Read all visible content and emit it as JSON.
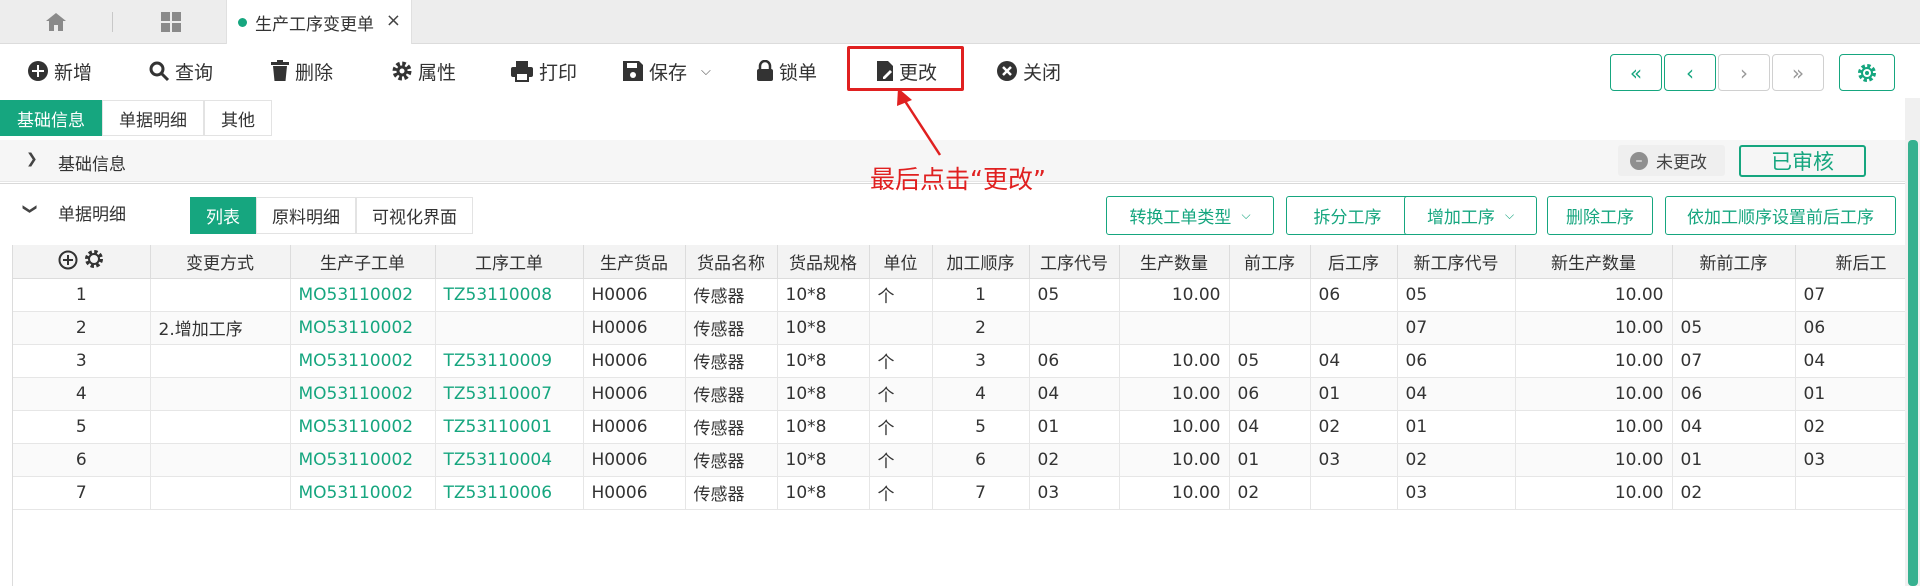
{
  "tabbar": {
    "doc_tab_label": "生产工序变更单",
    "close_glyph": "×"
  },
  "toolbar": {
    "new": "新增",
    "query": "查询",
    "delete": "删除",
    "properties": "属性",
    "print": "打印",
    "save": "保存",
    "lock": "锁单",
    "change": "更改",
    "close": "关闭"
  },
  "nav": {
    "first": "«",
    "prev": "‹",
    "next": "›",
    "last": "»"
  },
  "section_tabs": [
    "基础信息",
    "单据明细",
    "其他"
  ],
  "basic": {
    "title": "基础信息",
    "status": "未更改",
    "audited": "已审核"
  },
  "detail": {
    "title": "单据明细",
    "subtabs": [
      "列表",
      "原料明细",
      "可视化界面"
    ],
    "actions": {
      "convert_type": "转换工单类型",
      "split": "拆分工序",
      "add": "增加工序",
      "delete": "删除工序",
      "set_order": "依加工顺序设置前后工序"
    }
  },
  "annotation": "最后点击“更改”",
  "colors": {
    "accent": "#16a67f",
    "annotation": "#e02020"
  },
  "table": {
    "headers": [
      "",
      "变更方式",
      "生产子工单",
      "工序工单",
      "生产货品",
      "货品名称",
      "货品规格",
      "单位",
      "加工顺序",
      "工序代号",
      "生产数量",
      "前工序",
      "后工序",
      "新工序代号",
      "新生产数量",
      "新前工序",
      "新后工"
    ],
    "rows": [
      [
        "1",
        "",
        "MO53110002",
        "TZ53110008",
        "H0006",
        "传感器",
        "10*8",
        "个",
        "1",
        "05",
        "10.00",
        "",
        "06",
        "05",
        "10.00",
        "",
        "07"
      ],
      [
        "2",
        "2.增加工序",
        "MO53110002",
        "",
        "H0006",
        "传感器",
        "10*8",
        "",
        "2",
        "",
        "",
        "",
        "",
        "07",
        "10.00",
        "05",
        "06"
      ],
      [
        "3",
        "",
        "MO53110002",
        "TZ53110009",
        "H0006",
        "传感器",
        "10*8",
        "个",
        "3",
        "06",
        "10.00",
        "05",
        "04",
        "06",
        "10.00",
        "07",
        "04"
      ],
      [
        "4",
        "",
        "MO53110002",
        "TZ53110007",
        "H0006",
        "传感器",
        "10*8",
        "个",
        "4",
        "04",
        "10.00",
        "06",
        "01",
        "04",
        "10.00",
        "06",
        "01"
      ],
      [
        "5",
        "",
        "MO53110002",
        "TZ53110001",
        "H0006",
        "传感器",
        "10*8",
        "个",
        "5",
        "01",
        "10.00",
        "04",
        "02",
        "01",
        "10.00",
        "04",
        "02"
      ],
      [
        "6",
        "",
        "MO53110002",
        "TZ53110004",
        "H0006",
        "传感器",
        "10*8",
        "个",
        "6",
        "02",
        "10.00",
        "01",
        "03",
        "02",
        "10.00",
        "01",
        "03"
      ],
      [
        "7",
        "",
        "MO53110002",
        "TZ53110006",
        "H0006",
        "传感器",
        "10*8",
        "个",
        "7",
        "03",
        "10.00",
        "02",
        "",
        "03",
        "10.00",
        "02",
        ""
      ]
    ]
  }
}
